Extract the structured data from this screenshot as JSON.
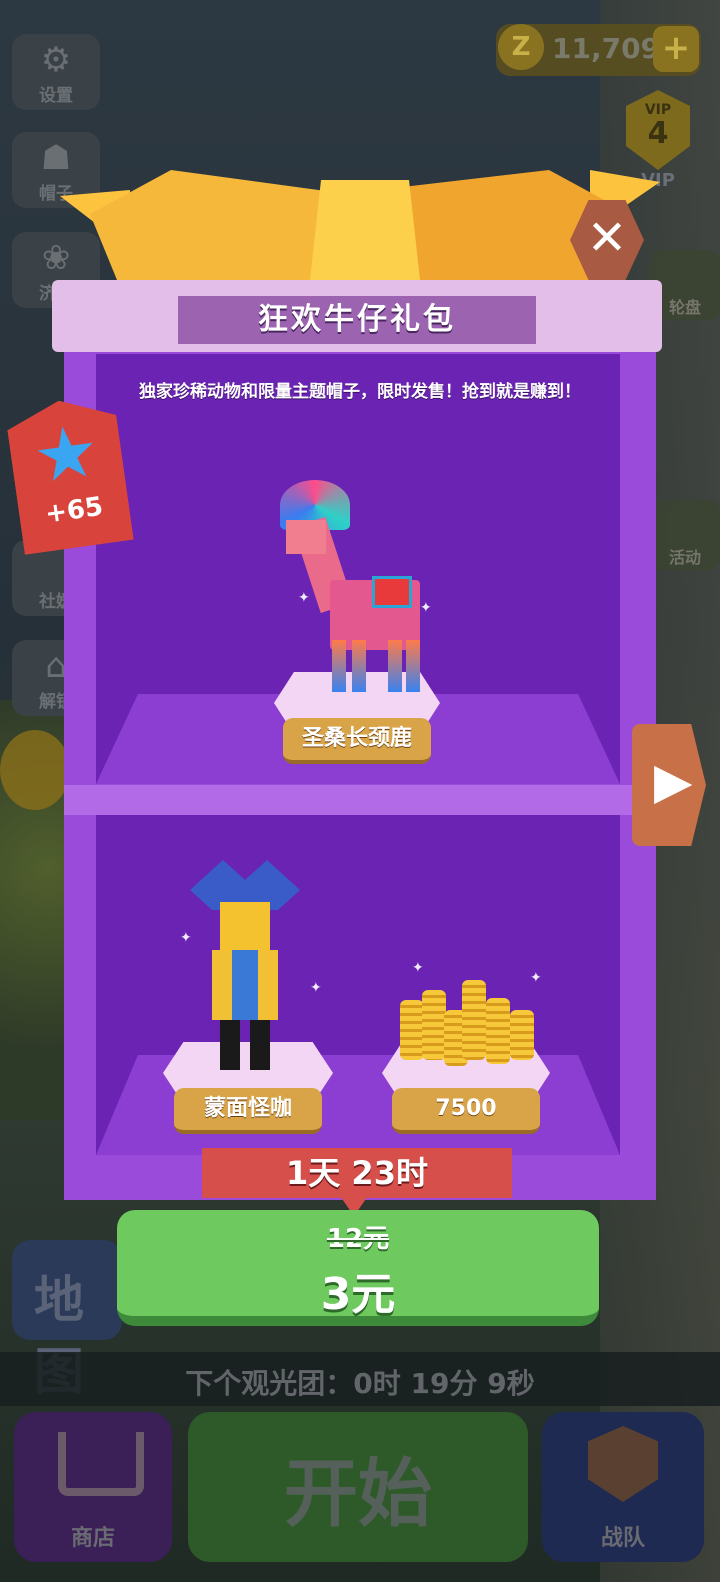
{
  "top": {
    "coin_icon": "Z",
    "coins": "11,709",
    "add": "+",
    "vip_label": "VIP",
    "vip_level": "4",
    "vip_text": "VIP"
  },
  "left_menu": {
    "settings": "设置",
    "hats": "帽子",
    "item3": "济启",
    "item4": "社媛",
    "item5": "解锁"
  },
  "right_menu": {
    "item1": "轮盘",
    "item2": "活动"
  },
  "popup": {
    "title": "狂欢牛仔礼包",
    "description": "独家珍稀动物和限量主题帽子，限时发售！抢到就是赚到！",
    "tag_bonus": "+65",
    "items": [
      {
        "name": "圣桑长颈鹿"
      },
      {
        "name": "蒙面怪咖"
      },
      {
        "name": "7500"
      }
    ],
    "timer": "1天 23时",
    "old_price": "12元",
    "new_price": "3元",
    "close_icon": "close-icon",
    "next_icon": "arrow-right-icon"
  },
  "bottom": {
    "map": "地图",
    "next_tour": "下个观光团：0时 19分 9秒",
    "shop": "商店",
    "start": "开始",
    "team": "战队"
  },
  "colors": {
    "popup_purple": "#9a4bd9",
    "buy_green": "#6ec95e",
    "ribbon_red": "#d64f4a",
    "gold": "#f6b83a"
  }
}
